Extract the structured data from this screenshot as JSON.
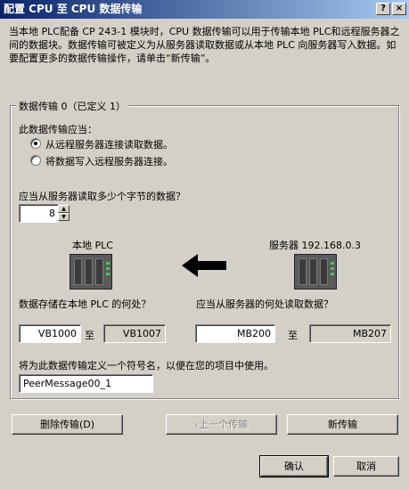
{
  "window": {
    "title": "配置 CPU 至 CPU 数据传输",
    "help_label": "?",
    "close_label": "×"
  },
  "intro": {
    "text": "当本地 PLC配备 CP 243-1 模块时，CPU 数据传输可以用于传输本地 PLC和远程服务器之间的数据块。数据传输可被定义为从服务器读取数据或从本地 PLC 向服务器写入数据。如要配置更多的数据传输操作，请单击“新传输”。"
  },
  "group": {
    "title": "数据传输 0（已定义 1）",
    "transfer_prompt": "此数据传输应当：",
    "option_read": "从远程服务器连接读取数据。",
    "option_write": "将数据写入远程服务器连接。",
    "bytes_question": "应当从服务器读取多少个字节的数据？",
    "bytes_value": "8",
    "local_label": "本地 PLC",
    "server_label": "服务器 192.168.0.3",
    "local_store_question": "数据存储在本地 PLC 的何处？",
    "server_read_question": "应当从服务器的何处读取数据？",
    "local_start": "VB1000",
    "local_to": "至",
    "local_end": "VB1007",
    "server_start": "MB200",
    "server_to": "至",
    "server_end": "MB207",
    "symbol_prompt": "将为此数据传输定义一个符号名，以便在您的项目中使用。",
    "symbol_value": "PeerMessage00_1"
  },
  "buttons": {
    "delete": "删除传输(D)",
    "previous": "‹上一个传输",
    "new": "新传输",
    "ok": "确认",
    "cancel": "取消"
  }
}
